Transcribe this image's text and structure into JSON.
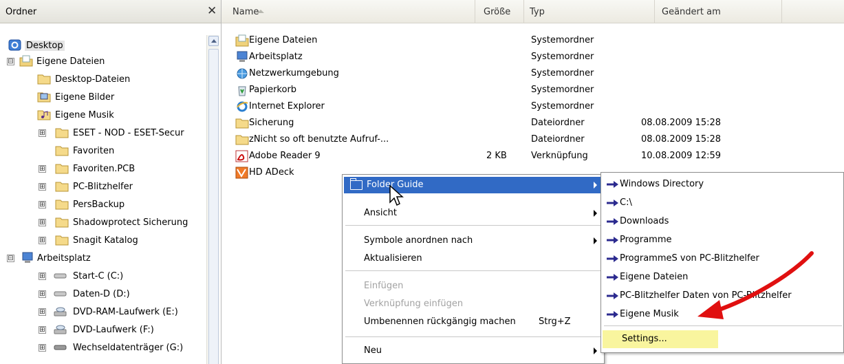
{
  "tree": {
    "title": "Ordner",
    "items": [
      {
        "label": "Desktop"
      },
      {
        "label": "Eigene Dateien",
        "expander": "⊟"
      },
      {
        "label": "Desktop-Dateien"
      },
      {
        "label": "Eigene Bilder"
      },
      {
        "label": "Eigene Musik"
      },
      {
        "label": "ESET - NOD - ESET-Secur",
        "expander": "⊞"
      },
      {
        "label": "Favoriten"
      },
      {
        "label": "Favoriten.PCB",
        "expander": "⊞"
      },
      {
        "label": "PC-Blitzhelfer",
        "expander": "⊞"
      },
      {
        "label": "PersBackup",
        "expander": "⊞"
      },
      {
        "label": "Shadowprotect Sicherung",
        "expander": "⊞"
      },
      {
        "label": "Snagit Katalog",
        "expander": "⊞"
      },
      {
        "label": "Arbeitsplatz",
        "expander": "⊟"
      },
      {
        "label": "Start-C (C:)",
        "expander": "⊞"
      },
      {
        "label": "Daten-D (D:)",
        "expander": "⊞"
      },
      {
        "label": "DVD-RAM-Laufwerk (E:)",
        "expander": "⊞"
      },
      {
        "label": "DVD-Laufwerk (F:)",
        "expander": "⊞"
      },
      {
        "label": "Wechseldatenträger (G:)",
        "expander": "⊞"
      }
    ]
  },
  "files": {
    "columns": {
      "name": "Name",
      "size": "Größe",
      "type": "Typ",
      "modified": "Geändert am"
    },
    "rows": [
      {
        "name": "Eigene Dateien",
        "size": "",
        "type": "Systemordner",
        "modified": ""
      },
      {
        "name": "Arbeitsplatz",
        "size": "",
        "type": "Systemordner",
        "modified": ""
      },
      {
        "name": "Netzwerkumgebung",
        "size": "",
        "type": "Systemordner",
        "modified": ""
      },
      {
        "name": "Papierkorb",
        "size": "",
        "type": "Systemordner",
        "modified": ""
      },
      {
        "name": "Internet Explorer",
        "size": "",
        "type": "Systemordner",
        "modified": ""
      },
      {
        "name": "Sicherung",
        "size": "",
        "type": "Dateiordner",
        "modified": "08.08.2009 15:28"
      },
      {
        "name": "zNicht so oft benutzte Aufruf-...",
        "size": "",
        "type": "Dateiordner",
        "modified": "08.08.2009 15:28"
      },
      {
        "name": "Adobe Reader 9",
        "size": "2 KB",
        "type": "Verknüpfung",
        "modified": "10.08.2009 12:59"
      },
      {
        "name": "HD ADeck",
        "size": "",
        "type": "",
        "modified": ""
      }
    ]
  },
  "context_menu": {
    "folder_guide": "Folder Guide",
    "ansicht": "Ansicht",
    "symbole": "Symbole anordnen nach",
    "aktualisieren": "Aktualisieren",
    "einfuegen": "Einfügen",
    "verknuepfung": "Verknüpfung einfügen",
    "umbenennen": "Umbenennen rückgängig machen",
    "umbenennen_shortcut": "Strg+Z",
    "neu": "Neu"
  },
  "submenu": {
    "items": [
      "Windows Directory",
      "C:\\",
      "Downloads",
      "Programme",
      "ProgrammeS  von PC-Blitzhelfer",
      "Eigene Dateien",
      "PC-Blitzhelfer  Daten von PC-Blitzhelfer",
      "Eigene Musik"
    ],
    "settings": "Settings..."
  },
  "colors": {
    "menu_highlight": "#316ac5",
    "settings_highlight": "#f9f59e",
    "annotation_arrow": "#e01010",
    "submenu_arrow": "#2b2a8f"
  }
}
